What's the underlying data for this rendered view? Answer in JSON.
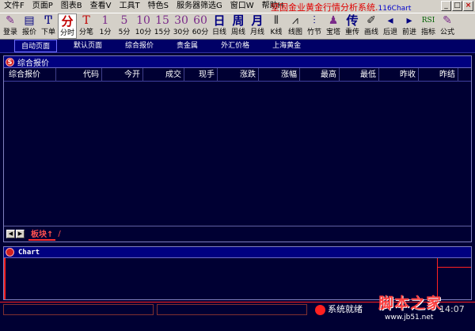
{
  "menu": {
    "items": [
      "文件F",
      "页面P",
      "图表B",
      "查看V",
      "工具T",
      "特色S",
      "服务器筛选G",
      "窗口W",
      "帮助H"
    ],
    "app_title": "坚固金业黄金行情分析系统.",
    "app_title_suffix": "116Chart",
    "window_controls": [
      "minimize-icon",
      "restore-icon",
      "close-icon"
    ]
  },
  "toolbar": {
    "items": [
      {
        "icon": "login-icon",
        "glyph": "✎",
        "label": "登录"
      },
      {
        "icon": "quote-icon",
        "glyph": "▤",
        "label": "报价"
      },
      {
        "icon": "order-icon",
        "glyph": "Ͳ",
        "label": "下单"
      },
      {
        "icon": "minute-chart-icon",
        "glyph": "分",
        "label": "分时"
      },
      {
        "icon": "tick-icon",
        "glyph": "T",
        "label": "分笔"
      },
      {
        "icon": "1min-icon",
        "glyph": "1",
        "label": "1分"
      },
      {
        "icon": "5min-icon",
        "glyph": "5",
        "label": "5分"
      },
      {
        "icon": "10min-icon",
        "glyph": "10",
        "label": "10分"
      },
      {
        "icon": "15min-icon",
        "glyph": "15",
        "label": "15分"
      },
      {
        "icon": "30min-icon",
        "glyph": "30",
        "label": "30分"
      },
      {
        "icon": "60min-icon",
        "glyph": "60",
        "label": "60分"
      },
      {
        "icon": "daily-icon",
        "glyph": "日",
        "label": "日线"
      },
      {
        "icon": "weekly-icon",
        "glyph": "周",
        "label": "周线"
      },
      {
        "icon": "monthly-icon",
        "glyph": "月",
        "label": "月线"
      },
      {
        "icon": "kline-icon",
        "glyph": "⫴",
        "label": "K线"
      },
      {
        "icon": "line-chart-icon",
        "glyph": "⩘",
        "label": "线图"
      },
      {
        "icon": "bamboo-icon",
        "glyph": "⫶",
        "label": "竹节"
      },
      {
        "icon": "tower-icon",
        "glyph": "♟",
        "label": "宝塔"
      },
      {
        "icon": "rebroadcast-icon",
        "glyph": "传",
        "label": "重传"
      },
      {
        "icon": "draw-line-icon",
        "glyph": "✐",
        "label": "画线"
      },
      {
        "icon": "back-icon",
        "glyph": "◂",
        "label": "后退"
      },
      {
        "icon": "forward-icon",
        "glyph": "▸",
        "label": "前进"
      },
      {
        "icon": "indicator-icon",
        "glyph": "RSI",
        "label": "指标"
      },
      {
        "icon": "formula-icon",
        "glyph": "✎",
        "label": "公式"
      }
    ]
  },
  "page_tabs": [
    "自动页面",
    "默认页面",
    "综合报价",
    "贵金属",
    "外汇价格",
    "上海黄金"
  ],
  "quote_panel": {
    "title": "综合报价",
    "columns": [
      "综合报价",
      "代码",
      "今开",
      "成交",
      "现手",
      "涨跌",
      "涨幅",
      "最高",
      "最低",
      "昨收",
      "昨结"
    ],
    "footer_tab": "板块↑"
  },
  "chart_panel": {
    "title": "Chart"
  },
  "status": {
    "text": "系统就绪",
    "time": "14:07"
  },
  "watermark": {
    "title": "脚本之家",
    "url": "www.jb51.net"
  },
  "colors": {
    "background": "#000033",
    "title_red": "#e00000",
    "accent_red": "#ff2020",
    "header_navy": "#000080"
  }
}
